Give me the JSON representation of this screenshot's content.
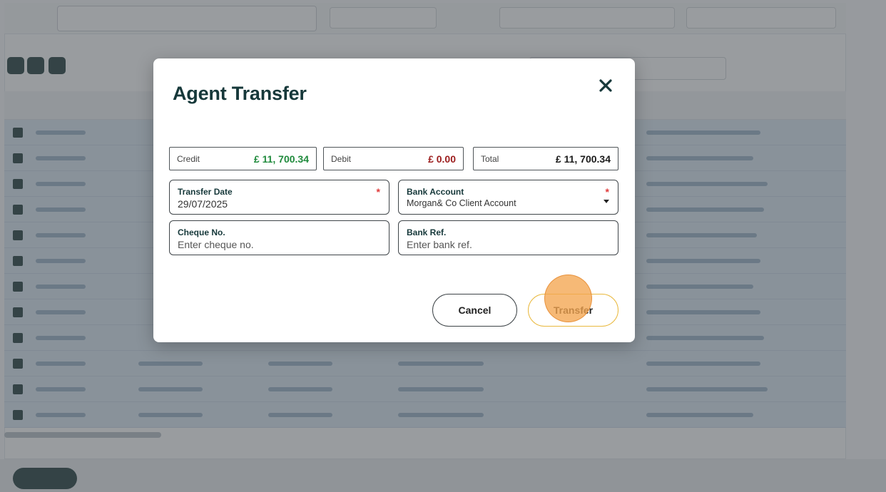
{
  "modal": {
    "title": "Agent Transfer",
    "close_icon": "close-icon"
  },
  "summary": {
    "credit_label": "Credit",
    "credit_value": "£ 11, 700.34",
    "debit_label": "Debit",
    "debit_value": "£ 0.00",
    "total_label": "Total",
    "total_value": "£ 11, 700.34"
  },
  "form": {
    "transfer_date_label": "Transfer Date",
    "transfer_date_value": "29/07/2025",
    "bank_account_label": "Bank Account",
    "bank_account_value": "Morgan& Co Client Account",
    "cheque_label": "Cheque No.",
    "cheque_placeholder": "Enter cheque no.",
    "bank_ref_label": "Bank Ref.",
    "bank_ref_placeholder": "Enter bank ref.",
    "required_marker": "*"
  },
  "actions": {
    "cancel_label": "Cancel",
    "transfer_label": "Transfer"
  },
  "colors": {
    "credit": "#1f8a3c",
    "debit": "#9b1c1c",
    "primary_dark": "#16383a",
    "transfer_border": "#e9b93f",
    "click_indicator": "#f4a550"
  }
}
